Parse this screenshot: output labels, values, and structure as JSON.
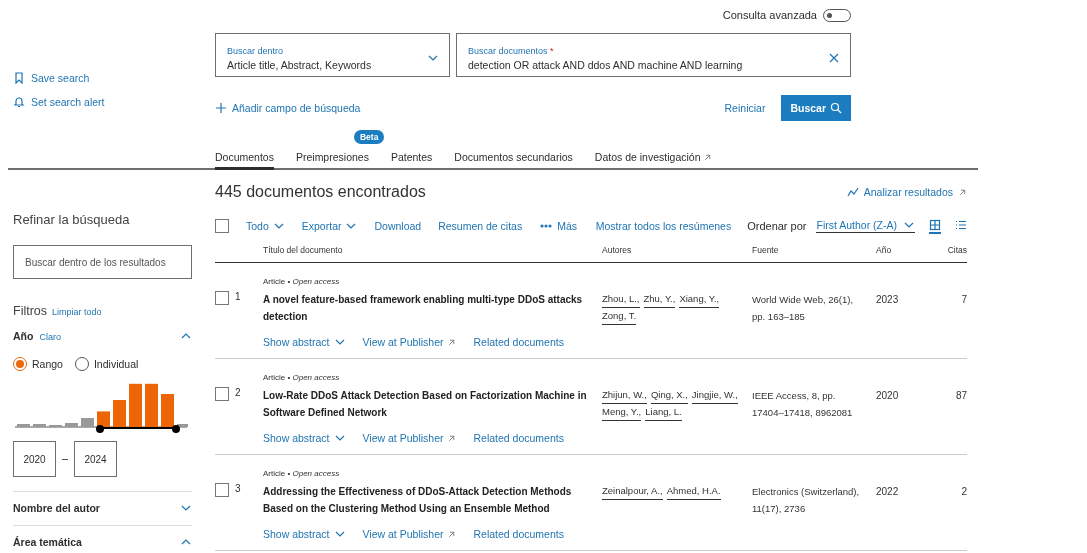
{
  "advanced_query": {
    "label": "Consulta avanzada",
    "on": false
  },
  "side_actions": [
    {
      "kind": "bookmark",
      "label": "Save search"
    },
    {
      "kind": "bell",
      "label": "Set search alert"
    }
  ],
  "search_fields": [
    {
      "kind": "select",
      "label": "Buscar dentro",
      "value": "Article title, Abstract, Keywords"
    },
    {
      "kind": "text",
      "label": "Buscar documentos",
      "required_mark": "*",
      "value": "detection OR attack AND ddos AND machine AND learning"
    }
  ],
  "add_field": "Añadir campo de búsqueda",
  "reset_button": "Reiniciar",
  "search_button": "Buscar",
  "tabs": [
    {
      "label": "Documentos",
      "selected": true
    },
    {
      "label": "Preimpresiones",
      "selected": false,
      "badge": "Beta"
    },
    {
      "label": "Patentes",
      "selected": false
    },
    {
      "label": "Documentos secundarios",
      "selected": false
    },
    {
      "label": "Datos de investigación",
      "selected": false,
      "external": true
    }
  ],
  "results_count": "445 documentos encontrados",
  "analyze_link": "Analizar resultados",
  "sidebar": {
    "title": "Refinar la búsqueda",
    "search_placeholder": "Buscar dentro de los resultados",
    "filters_title": "Filtros",
    "clear_all": "Limpiar todo",
    "year": {
      "label": "Año",
      "clear": "Claro",
      "expanded": true,
      "modes": [
        {
          "label": "Rango",
          "selected": true
        },
        {
          "label": "Individual",
          "selected": false
        }
      ],
      "from": "2020",
      "to": "2024"
    },
    "sections": [
      {
        "label": "Nombre del autor",
        "expanded": false
      },
      {
        "label": "Área temática",
        "expanded": true
      }
    ]
  },
  "toolbar": {
    "select_all": {
      "checked": false
    },
    "actions": [
      {
        "label": "Todo",
        "kind": "dropdown"
      },
      {
        "label": "Exportar",
        "kind": "dropdown"
      },
      {
        "label": "Download",
        "kind": "link"
      },
      {
        "label": "Resumen de citas",
        "kind": "link"
      },
      {
        "label": "Más",
        "kind": "more"
      }
    ],
    "show_all_abstracts": "Mostrar todos los resúmenes",
    "sort_label": "Ordenar por",
    "sort_value": "First Author (Z-A)",
    "views": [
      {
        "kind": "grid",
        "selected": true
      },
      {
        "kind": "list",
        "selected": false
      }
    ]
  },
  "table": {
    "columns": [
      "Título del documento",
      "Autores",
      "Fuente",
      "Año",
      "Citas"
    ],
    "rows": [
      {
        "number": "1",
        "checked": false,
        "meta": "Article • *Open access*",
        "title": "A novel feature-based framework enabling multi-type DDoS attacks detection",
        "authors": [
          "Zhou, L.,",
          "Zhu, Y.,",
          "Xiang, Y.,",
          "Zong, T."
        ],
        "source": "World Wide Web, 26(1), pp. 163–185",
        "year": "2023",
        "citations": "7",
        "actions": [
          "Show abstract",
          "View at Publisher",
          "Related documents"
        ]
      },
      {
        "number": "2",
        "checked": false,
        "meta": "Article • *Open access*",
        "title": "Low-Rate DDoS Attack Detection Based on Factorization Machine in Software Defined Network",
        "authors": [
          "Zhijun, W.,",
          "Qing, X.,",
          "Jingjie, W.,",
          "Meng, Y.,",
          "Liang, L."
        ],
        "source": "IEEE Access, 8, pp. 17404–17418, 8962081",
        "year": "2020",
        "citations": "87",
        "actions": [
          "Show abstract",
          "View at Publisher",
          "Related documents"
        ]
      },
      {
        "number": "3",
        "checked": false,
        "meta": "Article • *Open access*",
        "title": "Addressing the Effectiveness of DDoS-Attack Detection Methods Based on the Clustering Method Using an Ensemble Method",
        "authors": [
          "Zeinalpour, A.,",
          "Ahmed, H.A."
        ],
        "source": "Electronics (Switzerland), 11(17), 2736",
        "year": "2022",
        "citations": "2",
        "actions": [
          "Show abstract",
          "View at Publisher",
          "Related documents"
        ]
      }
    ]
  }
}
